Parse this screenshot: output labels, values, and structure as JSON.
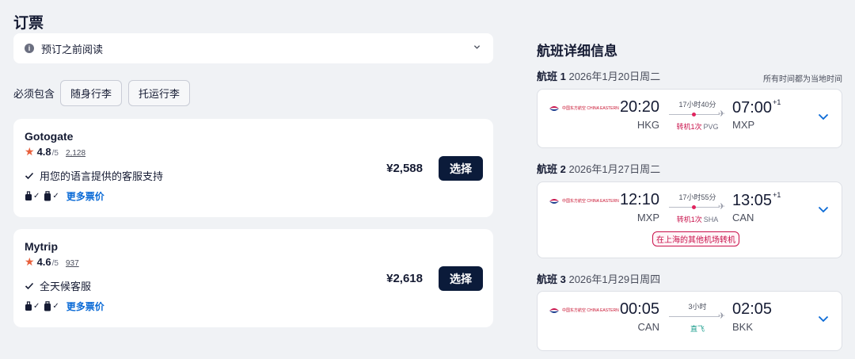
{
  "page_title": "订票",
  "read_before": {
    "label": "预订之前阅读",
    "icon": "info-icon"
  },
  "baggage": {
    "label": "必须包含",
    "chips": [
      "随身行李",
      "托运行李"
    ]
  },
  "offers": [
    {
      "name": "Gotogate",
      "score": "4.8",
      "out_of": "/5",
      "reviews": "2,128",
      "feature": "用您的语言提供的客服支持",
      "more_link": "更多票价",
      "price": "¥2,588",
      "select_label": "选择"
    },
    {
      "name": "Mytrip",
      "score": "4.6",
      "out_of": "/5",
      "reviews": "937",
      "feature": "全天候客服",
      "more_link": "更多票价",
      "price": "¥2,618",
      "select_label": "选择"
    }
  ],
  "details": {
    "title": "航班详细信息",
    "timezone_note": "所有时间都为当地时间",
    "airline_logo_text": "中国东方航空 CHINA EASTERN",
    "accent_color": "#c8104a",
    "flights": [
      {
        "label": "航班 1",
        "date": "2026年1月20日周二",
        "dep_time": "20:20",
        "dep_airport": "HKG",
        "duration": "17小时40分",
        "stop_text": "转机1次",
        "stop_airport": "PVG",
        "arr_time": "07:00",
        "arr_offset": "+1",
        "arr_airport": "MXP"
      },
      {
        "label": "航班 2",
        "date": "2026年1月27日周二",
        "dep_time": "12:10",
        "dep_airport": "MXP",
        "duration": "17小时55分",
        "stop_text": "转机1次",
        "stop_airport": "SHA",
        "arr_time": "13:05",
        "arr_offset": "+1",
        "arr_airport": "CAN",
        "warning": "在上海的其他机场转机"
      },
      {
        "label": "航班 3",
        "date": "2026年1月29日周四",
        "dep_time": "00:05",
        "dep_airport": "CAN",
        "duration": "3小时",
        "stop_text": "直飞",
        "arr_time": "02:05",
        "arr_airport": "BKK"
      }
    ]
  }
}
